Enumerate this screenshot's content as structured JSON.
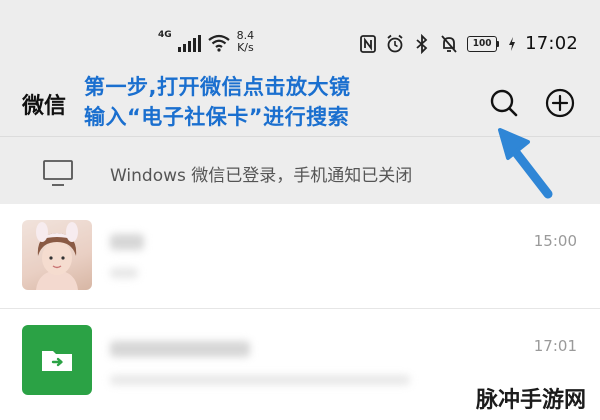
{
  "status_bar": {
    "network_type": "4G",
    "net_speed_value": "8.4",
    "net_speed_unit": "K/s",
    "battery_level": "100",
    "time": "17:02",
    "icons": [
      "signal-icon",
      "wifi-icon",
      "nfc-icon",
      "alarm-icon",
      "bluetooth-icon",
      "mute-icon",
      "battery-icon",
      "charging-icon"
    ]
  },
  "header": {
    "title": "微信",
    "annotation_line1": "第一步,打开微信点击放大镜",
    "annotation_line2": "输入“电子社保卡”进行搜索",
    "search_icon": "search-icon",
    "add_icon": "add-circle-icon"
  },
  "notice": {
    "icon": "monitor-icon",
    "text": "Windows 微信已登录，手机通知已关闭"
  },
  "chats": [
    {
      "time": "15:00",
      "avatar": "photo"
    },
    {
      "time": "17:01",
      "avatar": "folder-icon"
    }
  ],
  "watermark": "脉冲手游网",
  "colors": {
    "annotation": "#1a6fcf",
    "arrow": "#2f86d6",
    "folder": "#2ba245",
    "background": "#ededed"
  }
}
